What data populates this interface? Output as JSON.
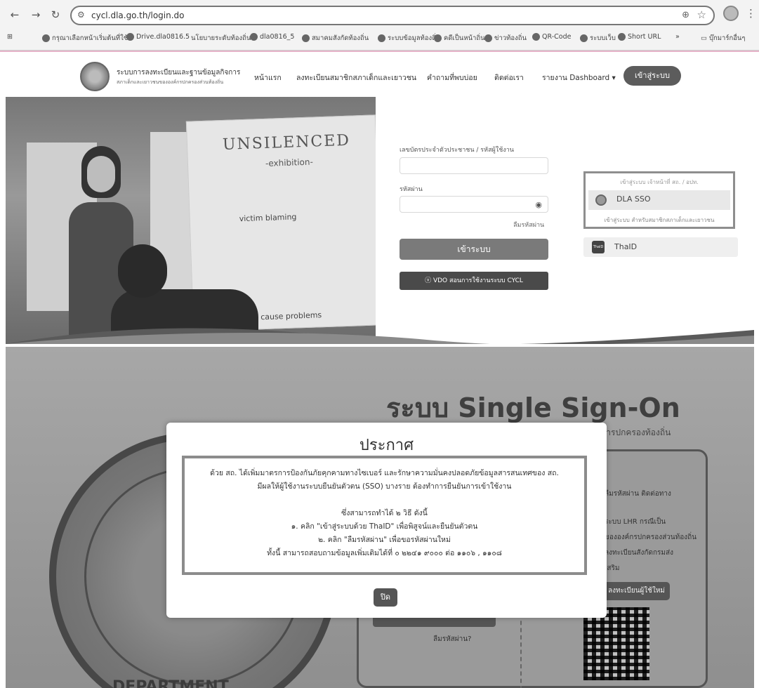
{
  "browser": {
    "url": "cycl.dla.go.th/login.do",
    "nav": {
      "back": "←",
      "forward": "→",
      "reload": "↻"
    },
    "bookmarks": [
      "กรุณาเลือกหน้าเริ่มต้นที่ใช้",
      "Drive.dla0816.5",
      "นโยบายระดับท้องถิ่น",
      "dla0816_5",
      "สมาคมสังกัดท้องถิ่น",
      "ระบบข้อมูลท้องถิ่น",
      "คดีเป็นหน้าถิ่น",
      "ข่าวท้องถิ่น",
      "QR-Code",
      "ระบบเว็บ",
      "Short URL",
      "บุ๊กมาร์กอื่นๆ"
    ]
  },
  "site": {
    "name": "ระบบการลงทะเบียนและฐานข้อมูลกิจการ",
    "subtitle": "สภาเด็กและเยาวชนขององค์กรปกครองส่วนท้องถิ่น",
    "menu": [
      "หน้าแรก",
      "ลงทะเบียนสมาชิกสภาเด็กและเยาวชน",
      "คำถามที่พบบ่อย",
      "ติดต่อเรา",
      "รายงาน Dashboard ▾"
    ],
    "login_button": "เข้าสู่ระบบ"
  },
  "hero": {
    "poster_title": "UNSILENCED",
    "poster_sub": "-exhibition-",
    "poster_lines": [
      "victim blaming",
      "root cause problems"
    ]
  },
  "login": {
    "id_label": "เลขบัตรประจำตัวประชาชน / รหัสผู้ใช้งาน",
    "password_label": "รหัสผ่าน",
    "forgot": "ลืมรหัสผ่าน",
    "submit": "เข้าระบบ",
    "vdo": "ⓥ VDO สอนการใช้งานระบบ CYCL",
    "sso_header": "เข้าสู่ระบบ เจ้าหน้าที่ สถ. / อปท.",
    "sso_label": "DLA SSO",
    "sso_footer": "เข้าสู่ระบบ สำหรับสมาชิกสภาเด็กและเยาวชน",
    "thaid_label": "ThaID",
    "thaid_icon": "ThaID"
  },
  "sso_page": {
    "title": "ระบบ Single Sign-On",
    "subtitle": "การปกครองท้องถิ่น",
    "right_col": [
      "ลืมรหัสผ่าน ติดต่อทาง",
      "ระบบ LHR กรณีเป็น",
      "ขององค์กรปกครองส่วนท้องถิ่น",
      "ลงทะเบียนสังกัดกรมส่ง",
      "เสริม"
    ],
    "register": "ลงทะเบียนผู้ใช้ใหม่",
    "forgot": "ลืมรหัสผ่าน?",
    "seal_text": "DEPARTMENT"
  },
  "modal": {
    "title": "ประกาศ",
    "lines": [
      "ด้วย สถ. ได้เพิ่มมาตรการป้องกันภัยคุกคามทางไซเบอร์ และรักษาความมั่นคงปลอดภัยข้อมูลสารสนเทศของ สถ.",
      "มีผลให้ผู้ใช้งานระบบยืนยันตัวตน (SSO) บางราย ต้องทำการยืนยันการเข้าใช้งาน",
      "",
      "ซึ่งสามารถทำได้ ๒ วิธี ดังนี้",
      "๑. คลิก \"เข้าสู่ระบบด้วย ThaID\" เพื่อพิสูจน์และยืนยันตัวตน",
      "๒. คลิก \"ลืมรหัสผ่าน\" เพื่อขอรหัสผ่านใหม่",
      "ทั้งนี้ สามารถสอบถามข้อมูลเพิ่มเติมได้ที่ ๐ ๒๒๔๑ ๙๐๐๐ ต่อ ๑๑๐๖ , ๑๑๐๘"
    ],
    "close": "ปิด"
  },
  "colors": {
    "accent": "#5c5c5c",
    "header_border": "#e6b4c9"
  }
}
